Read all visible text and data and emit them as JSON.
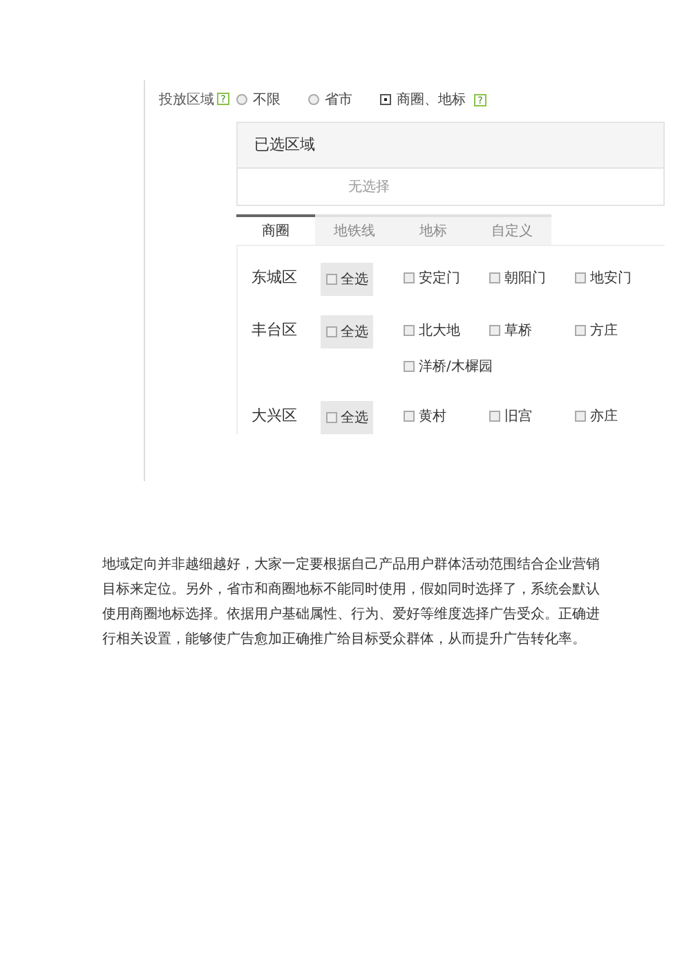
{
  "targeting": {
    "label": "投放区域",
    "help": "?",
    "options": [
      {
        "label": "不限",
        "selected": false
      },
      {
        "label": "省市",
        "selected": false
      },
      {
        "label": "商圈、地标",
        "selected": true,
        "help": "?"
      }
    ]
  },
  "selected_area": {
    "title": "已选区域",
    "empty_text": "无选择"
  },
  "tabs": [
    {
      "label": "商圈",
      "selected": true
    },
    {
      "label": "地铁线",
      "selected": false
    },
    {
      "label": "地标",
      "selected": false
    },
    {
      "label": "自定义",
      "selected": false
    }
  ],
  "districts": [
    {
      "name": "东城区",
      "select_all": {
        "label": "全选",
        "checked": false
      },
      "places": [
        {
          "label": "安定门",
          "checked": false
        },
        {
          "label": "朝阳门",
          "checked": false
        },
        {
          "label": "地安门",
          "checked": false
        }
      ]
    },
    {
      "name": "丰台区",
      "select_all": {
        "label": "全选",
        "checked": false
      },
      "places": [
        {
          "label": "北大地",
          "checked": false
        },
        {
          "label": "草桥",
          "checked": false
        },
        {
          "label": "方庄",
          "checked": false
        },
        {
          "label": "洋桥/木樨园",
          "checked": false
        }
      ]
    },
    {
      "name": "大兴区",
      "select_all": {
        "label": "全选",
        "checked": false
      },
      "places": [
        {
          "label": "黄村",
          "checked": false
        },
        {
          "label": "旧宫",
          "checked": false
        },
        {
          "label": "亦庄",
          "checked": false
        }
      ]
    }
  ],
  "paragraph": "地域定向并非越细越好，大家一定要根据自己产品用户群体活动范围结合企业营销目标来定位。另外，省市和商圈地标不能同时使用，假如同时选择了，系统会默认使用商圈地标选择。依据用户基础属性、行为、爱好等维度选择广告受众。正确进行相关设置，能够使广告愈加正确推广给目标受众群体，从而提升广告转化率。"
}
